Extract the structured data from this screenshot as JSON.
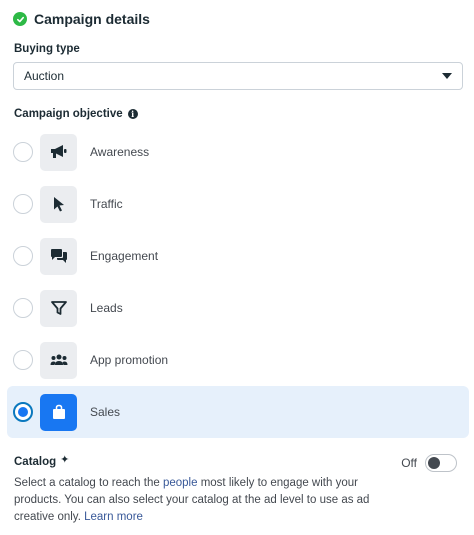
{
  "header": {
    "title": "Campaign details"
  },
  "buying_type": {
    "label": "Buying type",
    "value": "Auction"
  },
  "objective": {
    "label": "Campaign objective",
    "options": [
      {
        "label": "Awareness",
        "icon": "megaphone-icon",
        "selected": false
      },
      {
        "label": "Traffic",
        "icon": "cursor-icon",
        "selected": false
      },
      {
        "label": "Engagement",
        "icon": "chat-bubbles-icon",
        "selected": false
      },
      {
        "label": "Leads",
        "icon": "funnel-icon",
        "selected": false
      },
      {
        "label": "App promotion",
        "icon": "people-icon",
        "selected": false
      },
      {
        "label": "Sales",
        "icon": "shopping-bag-icon",
        "selected": true
      }
    ]
  },
  "catalog": {
    "title": "Catalog",
    "toggle_state": "Off",
    "desc_part1": "Select a catalog to reach the ",
    "desc_link1": "people",
    "desc_part2": " most likely to engage with your products. You can also select your catalog at the ad level to use as ad creative only. ",
    "desc_link2": "Learn more"
  },
  "colors": {
    "accent": "#1877f2",
    "selected_bg": "#e6f0fb",
    "success": "#2db946"
  }
}
